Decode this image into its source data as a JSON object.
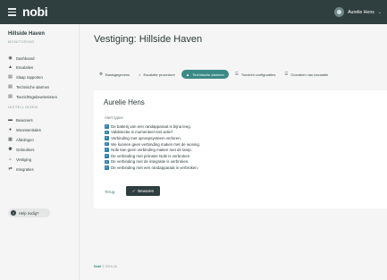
{
  "topbar": {
    "logo": "nobi",
    "user_name": "Aurelie Hens"
  },
  "sidebar": {
    "title": "Hillside Haven",
    "monitoring_label": "MONITORING",
    "monitoring_items": [
      {
        "label": "Dashboard",
        "icon": "gauge-icon"
      },
      {
        "label": "Escalaties",
        "icon": "alert-icon"
      },
      {
        "label": "Slaap rapporten",
        "icon": "report-icon"
      },
      {
        "label": "Technische alarmen",
        "icon": "report-icon"
      },
      {
        "label": "Toezichtsgebeurtenissen",
        "icon": "report-icon"
      }
    ],
    "settings_label": "INSTELLINGEN",
    "settings_items": [
      {
        "label": "Bewoners",
        "icon": "bed-icon"
      },
      {
        "label": "Woonsentrales",
        "icon": "hub-icon"
      },
      {
        "label": "Afdelingen",
        "icon": "ward-icon"
      },
      {
        "label": "Gebruikers",
        "icon": "users-icon"
      },
      {
        "label": "Vestiging",
        "icon": "home-icon"
      },
      {
        "label": "Integraties",
        "icon": "swap-icon"
      }
    ],
    "help_label": "Help nodig?"
  },
  "page": {
    "title": "Vestiging: Hillside Haven"
  },
  "tabs": [
    {
      "label": "Basisgegevens",
      "icon": "gear-icon",
      "active": false
    },
    {
      "label": "Escalatie procedure",
      "icon": "bell-icon",
      "active": false
    },
    {
      "label": "Technische alarmen",
      "icon": "warning-icon",
      "active": true
    },
    {
      "label": "Toezicht configuraties",
      "icon": "list-icon",
      "active": false
    },
    {
      "label": "Oorzaken van escalatie",
      "icon": "list-icon",
      "active": false
    }
  ],
  "card": {
    "title": "Aurelie Hens",
    "alert_types_label": "Alert types",
    "alerts": [
      "De batterij van een randapparaat is bijna leeg.",
      "Valdetectie is momenteel niet actief",
      "Verbinding met oproepsysteem verloren.",
      "We kunnen geen verbinding maken met de woning.",
      "Nobi kan geen verbinding maken met de lamp.",
      "De verbinding met primaire Nobi is verbroken",
      "De verbinding met de integratie is verbroken.",
      "De verbinding met een randapparaat is verbroken."
    ],
    "back_label": "Terug",
    "save_label": "Bewaren"
  },
  "footer": {
    "brand": "Nobi",
    "copyright": "© 2019-24"
  },
  "colors": {
    "topbar": "#2f3e3e",
    "accent": "#3b8a86",
    "checkbox": "#2f7fae"
  }
}
